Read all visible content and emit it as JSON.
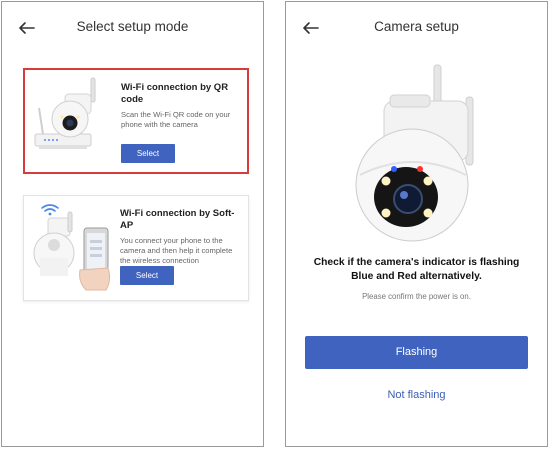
{
  "left_screen": {
    "header": {
      "title": "Select setup mode",
      "back_icon": "arrow-left-icon"
    },
    "cards": [
      {
        "title": "Wi-Fi connection by QR code",
        "description": "Scan the Wi-Fi QR code on your phone with the camera",
        "button_label": "Select",
        "selected": true
      },
      {
        "title": "Wi-Fi connection by Soft-AP",
        "description": "You connect your phone to the camera and then help it complete the wireless connection",
        "button_label": "Select",
        "selected": false
      }
    ]
  },
  "right_screen": {
    "header": {
      "title": "Camera setup",
      "back_icon": "arrow-left-icon"
    },
    "instruction_line1": "Check if the camera's indicator is flashing",
    "instruction_line2": "Blue and Red alternatively.",
    "confirm_power": "Please confirm the power is on.",
    "primary_button": "Flashing",
    "secondary_button": "Not flashing"
  },
  "colors": {
    "accent_blue": "#3f63bf",
    "selected_border": "#d93a3a",
    "link_blue": "#3b5fb5",
    "indicator_blue": "#2f5fff",
    "indicator_red": "#ff3030"
  }
}
